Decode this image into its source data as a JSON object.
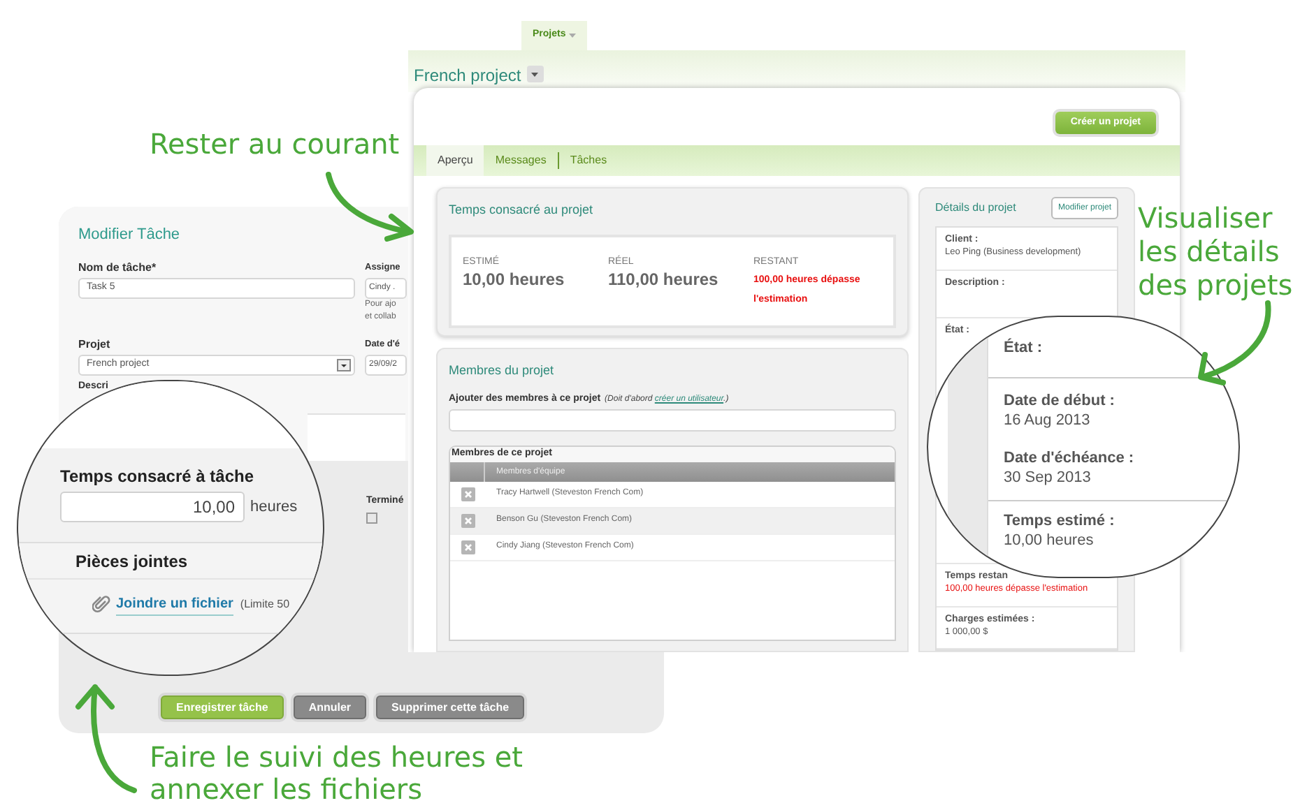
{
  "annotations": [
    {
      "text": "Rester au courant"
    },
    {
      "text": "Visualiser les détails des projets"
    },
    {
      "text": "Faire le suivi des heures et annexer les fichiers"
    }
  ],
  "task_editor": {
    "title": "Modifier Tâche",
    "fields": [
      {
        "label": "Nom de tâche*",
        "value": "Task 5",
        "kind": "text"
      },
      {
        "label": "Assigne",
        "value": "Cindy .",
        "kind": "text",
        "hint": [
          "Pour ajo",
          "et collab"
        ]
      },
      {
        "label": "Projet",
        "value": "French project",
        "kind": "select"
      },
      {
        "label": "Date d'é",
        "value": "29/09/2",
        "kind": "text"
      }
    ],
    "description_label": "Descri",
    "done": {
      "label": "Terminé",
      "checked": false
    },
    "buttons": [
      {
        "label": "Enregistrer tâche",
        "kind": "primary"
      },
      {
        "label": "Annuler",
        "kind": "secondary"
      },
      {
        "label": "Supprimer cette tâche",
        "kind": "secondary"
      }
    ]
  },
  "time_magnifier": {
    "label": "Temps consacré à tâche",
    "value": "10,00",
    "unit": "heures",
    "attachments_title": "Pièces jointes",
    "attach_link": "Joindre un fichier",
    "limit": "(Limite 50"
  },
  "project_window": {
    "nav_tabs": [
      {
        "label": "Projets",
        "selected": true
      }
    ],
    "project_name": "French project",
    "create_button": "Créer un projet",
    "tabs": [
      {
        "label": "Aperçu",
        "selected": true
      },
      {
        "label": "Messages",
        "selected": false
      },
      {
        "label": "Tâches",
        "selected": false
      }
    ],
    "time_card": {
      "title": "Temps consacré au projet",
      "stats": [
        {
          "label": "ESTIMÉ",
          "value": "10,00 heures",
          "alert": false
        },
        {
          "label": "RÉEL",
          "value": "110,00 heures",
          "alert": false
        },
        {
          "label": "RESTANT",
          "value": "100,00 heures dépasse l'estimation",
          "alert": true
        }
      ]
    },
    "members_card": {
      "title": "Membres du projet",
      "add_label": "Ajouter des membres à ce projet",
      "add_note": "(Doit d'abord ",
      "add_link": "créer un utilisateur",
      "add_note_end": ".)",
      "table_title": "Membres de ce projet",
      "column": "Membres d'équipe",
      "members": [
        "Tracy Hartwell (Steveston French Com)",
        "Benson Gu (Steveston French Com)",
        "Cindy Jiang (Steveston French Com)"
      ]
    },
    "details_card": {
      "title": "Détails du projet",
      "edit_button": "Modifier projet",
      "items": [
        {
          "label": "Client :",
          "value": "Leo Ping (Business development)",
          "alert": false
        },
        {
          "label": "Description :"
        },
        {
          "label": "État :"
        },
        {
          "label": "Temps restan",
          "value": "100,00 heures dépasse l'estimation",
          "alert": true
        },
        {
          "label": "Charges estimées :",
          "value": "1 000,00 $",
          "alert": false
        }
      ]
    }
  },
  "detail_magnifier": {
    "items": [
      {
        "label": "État :"
      },
      {
        "label": "Date de début :",
        "value": "16 Aug 2013"
      },
      {
        "label": "Date d'échéance :",
        "value": "30 Sep 2013"
      },
      {
        "label": "Temps estimé :",
        "value": "10,00 heures"
      }
    ]
  }
}
